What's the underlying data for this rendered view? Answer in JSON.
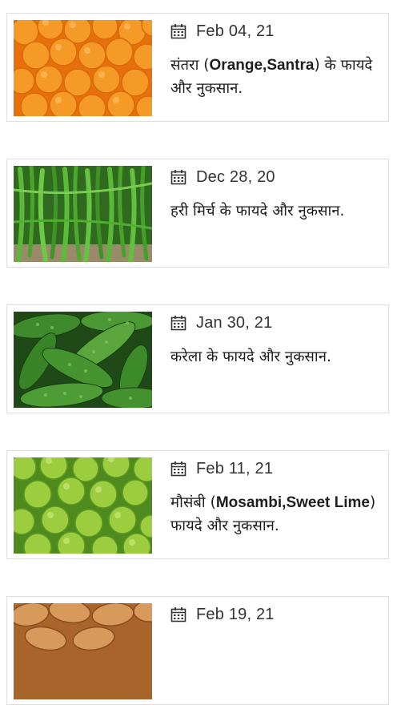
{
  "articles": [
    {
      "date": "Feb 04, 21",
      "title_pre": "संतरा (",
      "title_latin": "Orange,Santra",
      "title_post": ") के फायदे और नुकसान.",
      "image": "oranges",
      "accent": "#f08a1a"
    },
    {
      "date": "Dec 28, 20",
      "title_pre": "हरी मिर्च के फायदे और नुकसान.",
      "title_latin": "",
      "title_post": "",
      "image": "green-chillies",
      "accent": "#3a8f2a"
    },
    {
      "date": "Jan 30, 21",
      "title_pre": "करेला के फायदे और नुकसान.",
      "title_latin": "",
      "title_post": "",
      "image": "bitter-gourd",
      "accent": "#2d7a2a"
    },
    {
      "date": "Feb 11, 21",
      "title_pre": "मौसंबी (",
      "title_latin": "Mosambi,Sweet Lime",
      "title_post": ") फायदे और नुकसान.",
      "image": "sweet-lime",
      "accent": "#8cc43a"
    },
    {
      "date": "Feb 19, 21",
      "title_pre": "",
      "title_latin": "",
      "title_post": "",
      "image": "dates",
      "accent": "#c98a4a"
    }
  ]
}
